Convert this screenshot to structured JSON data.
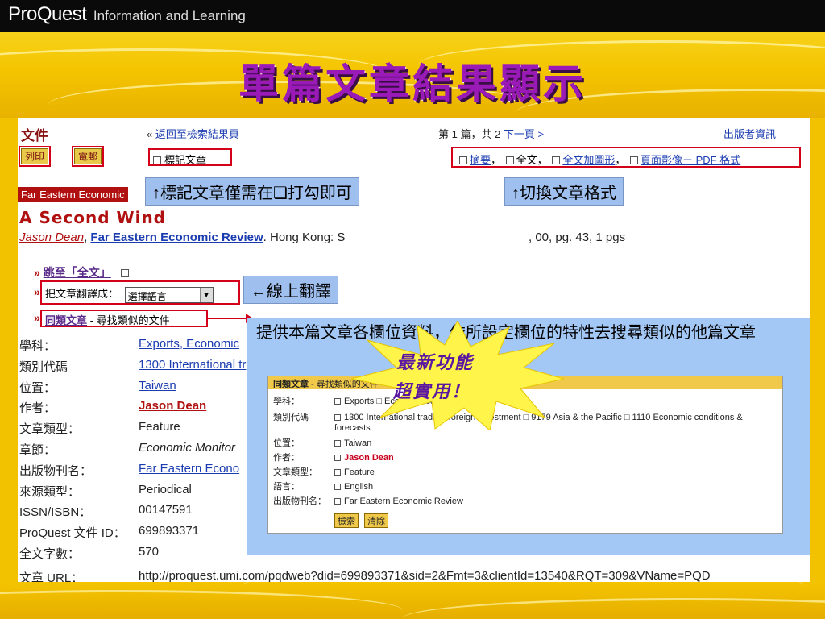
{
  "brand": {
    "name": "ProQuest",
    "tagline": "Information and Learning"
  },
  "slide_title": "單篇文章結果顯示",
  "header": {
    "doc_label": "文件",
    "back_prefix": "«",
    "back_link": "返回至檢索結果頁",
    "page_info": "第 1 篇，共 2",
    "next_link": "下一頁 >",
    "publisher_info": "出版者資訊"
  },
  "actions": {
    "print": "列印",
    "email": "電郵",
    "mark": "標記文章"
  },
  "formats": {
    "abstract": "摘要",
    "sep1": "，",
    "fulltext": "全文",
    "sep2": "，",
    "fulltext_graphics": "全文加圖形",
    "sep3": "，",
    "page_image": "頁面影像－ PDF 格式"
  },
  "callouts": {
    "mark_tip": "↑標記文章僅需在❏打勾即可",
    "format_tip": "↑切換文章格式",
    "translate_tip": "←線上翻譯",
    "panel_text": "提供本篇文章各欄位資料，依所設定欄位的特性去搜尋類似的他篇文章"
  },
  "starburst": {
    "line1": "最新功能",
    "line2": "超實用！"
  },
  "article": {
    "journal_logo": "Far Eastern Economic",
    "headline": "A Second Wind",
    "author": "Jason Dean",
    "sep": ", ",
    "publication": "Far Eastern Economic Review",
    "location": ". Hong Kong: S",
    "pages_tail": ", 00,  pg. 43, 1 pgs"
  },
  "tools": {
    "jump_label": "跳至「全文」",
    "translate_label": "把文章翻譯成：",
    "language_select": "選擇語言",
    "similar_label": "同類文章",
    "similar_desc": "- 尋找類似的文件"
  },
  "fields": [
    {
      "label": "學科：",
      "value": "Exports,  Economic",
      "link": true
    },
    {
      "label": "類別代碼",
      "value": "1300 International tr",
      "link": true
    },
    {
      "label": "位置：",
      "value": "Taiwan",
      "link": true
    },
    {
      "label": "作者：",
      "value": "Jason Dean",
      "link": true,
      "red": true
    },
    {
      "label": "文章類型：",
      "value": "Feature"
    },
    {
      "label": "章節：",
      "value": "Economic Monitor",
      "italic": true
    },
    {
      "label": "出版物刊名：",
      "value": "Far Eastern Econo",
      "link": true
    },
    {
      "label": "來源類型：",
      "value": "Periodical"
    },
    {
      "label": "ISSN/ISBN：",
      "value": "00147591"
    },
    {
      "label": "ProQuest 文件 ID：",
      "value": "699893371"
    },
    {
      "label": "全文字數：",
      "value": "570"
    }
  ],
  "url_row": {
    "label": "文章 URL：",
    "value": "http://proquest.umi.com/pqdweb?did=699893371&sid=2&Fmt=3&clientId=13540&RQT=309&VName=PQD"
  },
  "similar_panel": {
    "head_label": "同類文章",
    "head_desc": " - 尋找類似的文件",
    "rows": [
      {
        "k": "學科：",
        "v": "Exports  □ Economic conditions"
      },
      {
        "k": "類別代碼",
        "v": "1300 International trade & foreign investment  □ 9179 Asia & the Pacific  □ 1110 Economic conditions &"
      },
      {
        "k": "",
        "v": "forecasts"
      },
      {
        "k": "位置：",
        "v": "Taiwan"
      },
      {
        "k": "作者：",
        "v": "Jason Dean",
        "red": true
      },
      {
        "k": "文章類型：",
        "v": "Feature"
      },
      {
        "k": "語言：",
        "v": "English"
      },
      {
        "k": "出版物刊名：",
        "v": "Far Eastern Economic Review"
      }
    ],
    "search_btn": "檢索",
    "clear_btn": "清除"
  }
}
